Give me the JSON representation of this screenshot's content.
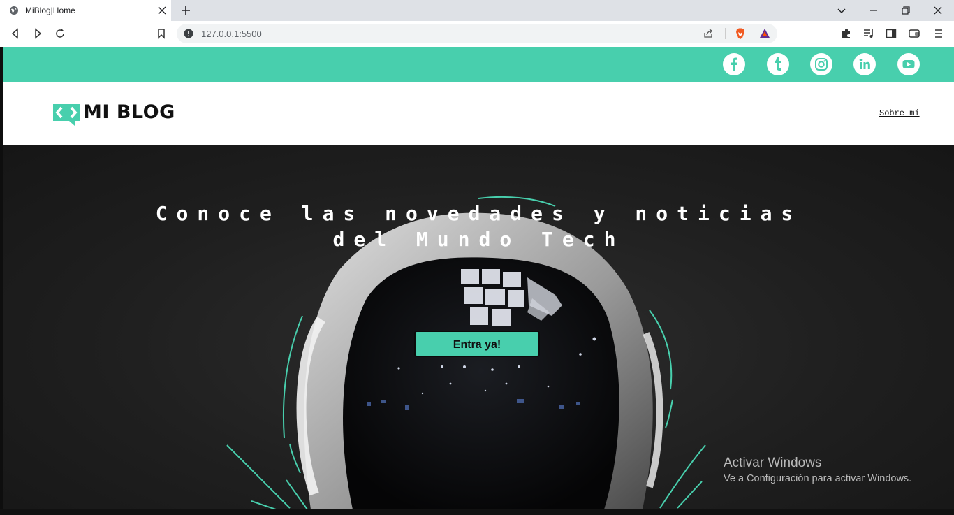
{
  "browser": {
    "tab_title": "MiBlog|Home",
    "url": "127.0.0.1:5500",
    "icons": [
      "globe-icon",
      "close-icon",
      "plus-icon",
      "chevron-down-icon",
      "minimize-icon",
      "restore-icon",
      "window-close-icon",
      "back-icon",
      "forward-icon",
      "reload-icon",
      "bookmark-icon",
      "info-icon",
      "share-icon",
      "brave-shields-icon",
      "brave-rewards-icon",
      "extensions-icon",
      "playlist-icon",
      "sidebar-icon",
      "wallet-icon",
      "menu-icon"
    ]
  },
  "site": {
    "social": [
      "facebook-icon",
      "tumblr-icon",
      "instagram-icon",
      "linkedin-icon",
      "youtube-icon"
    ],
    "logo_text": "MI BLOG",
    "nav": {
      "about": "Sobre mí"
    },
    "hero": {
      "title": "Conoce las novedades y noticias del Mundo Tech",
      "cta": "Entra ya!"
    }
  },
  "os": {
    "watermark_title": "Activar Windows",
    "watermark_subtitle": "Ve a Configuración para activar Windows."
  },
  "colors": {
    "accent": "#48cfad",
    "hero_bg": "#1f1f1f",
    "text_dark": "#111111"
  }
}
